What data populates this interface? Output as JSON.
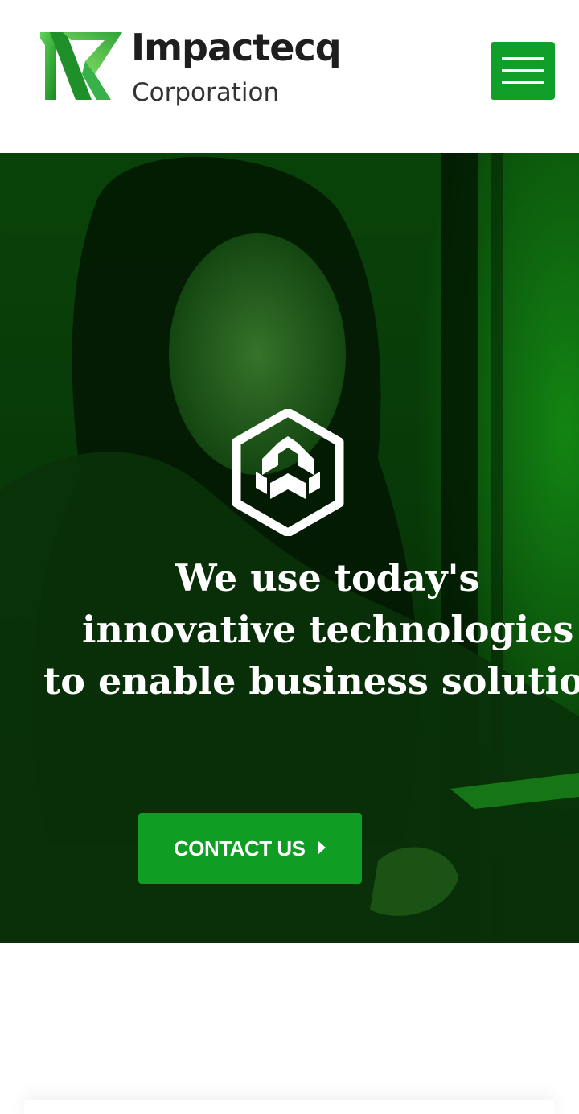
{
  "header": {
    "brand_name": "Impactecq",
    "brand_sub": "Corporation",
    "menu_icon": "hamburger-menu-icon"
  },
  "hero": {
    "heading_lines": [
      "We use today's",
      "innovative technologies",
      "to enable business solutions"
    ],
    "emblem_icon": "hexagon-arrows-emblem-icon",
    "cta": {
      "label": "CONTACT US",
      "icon": "caret-right-icon"
    }
  },
  "colors": {
    "brand_green": "#119f2a",
    "hero_overlay": "#0b4a0b",
    "text_dark": "#1e1e1e",
    "white": "#ffffff"
  }
}
